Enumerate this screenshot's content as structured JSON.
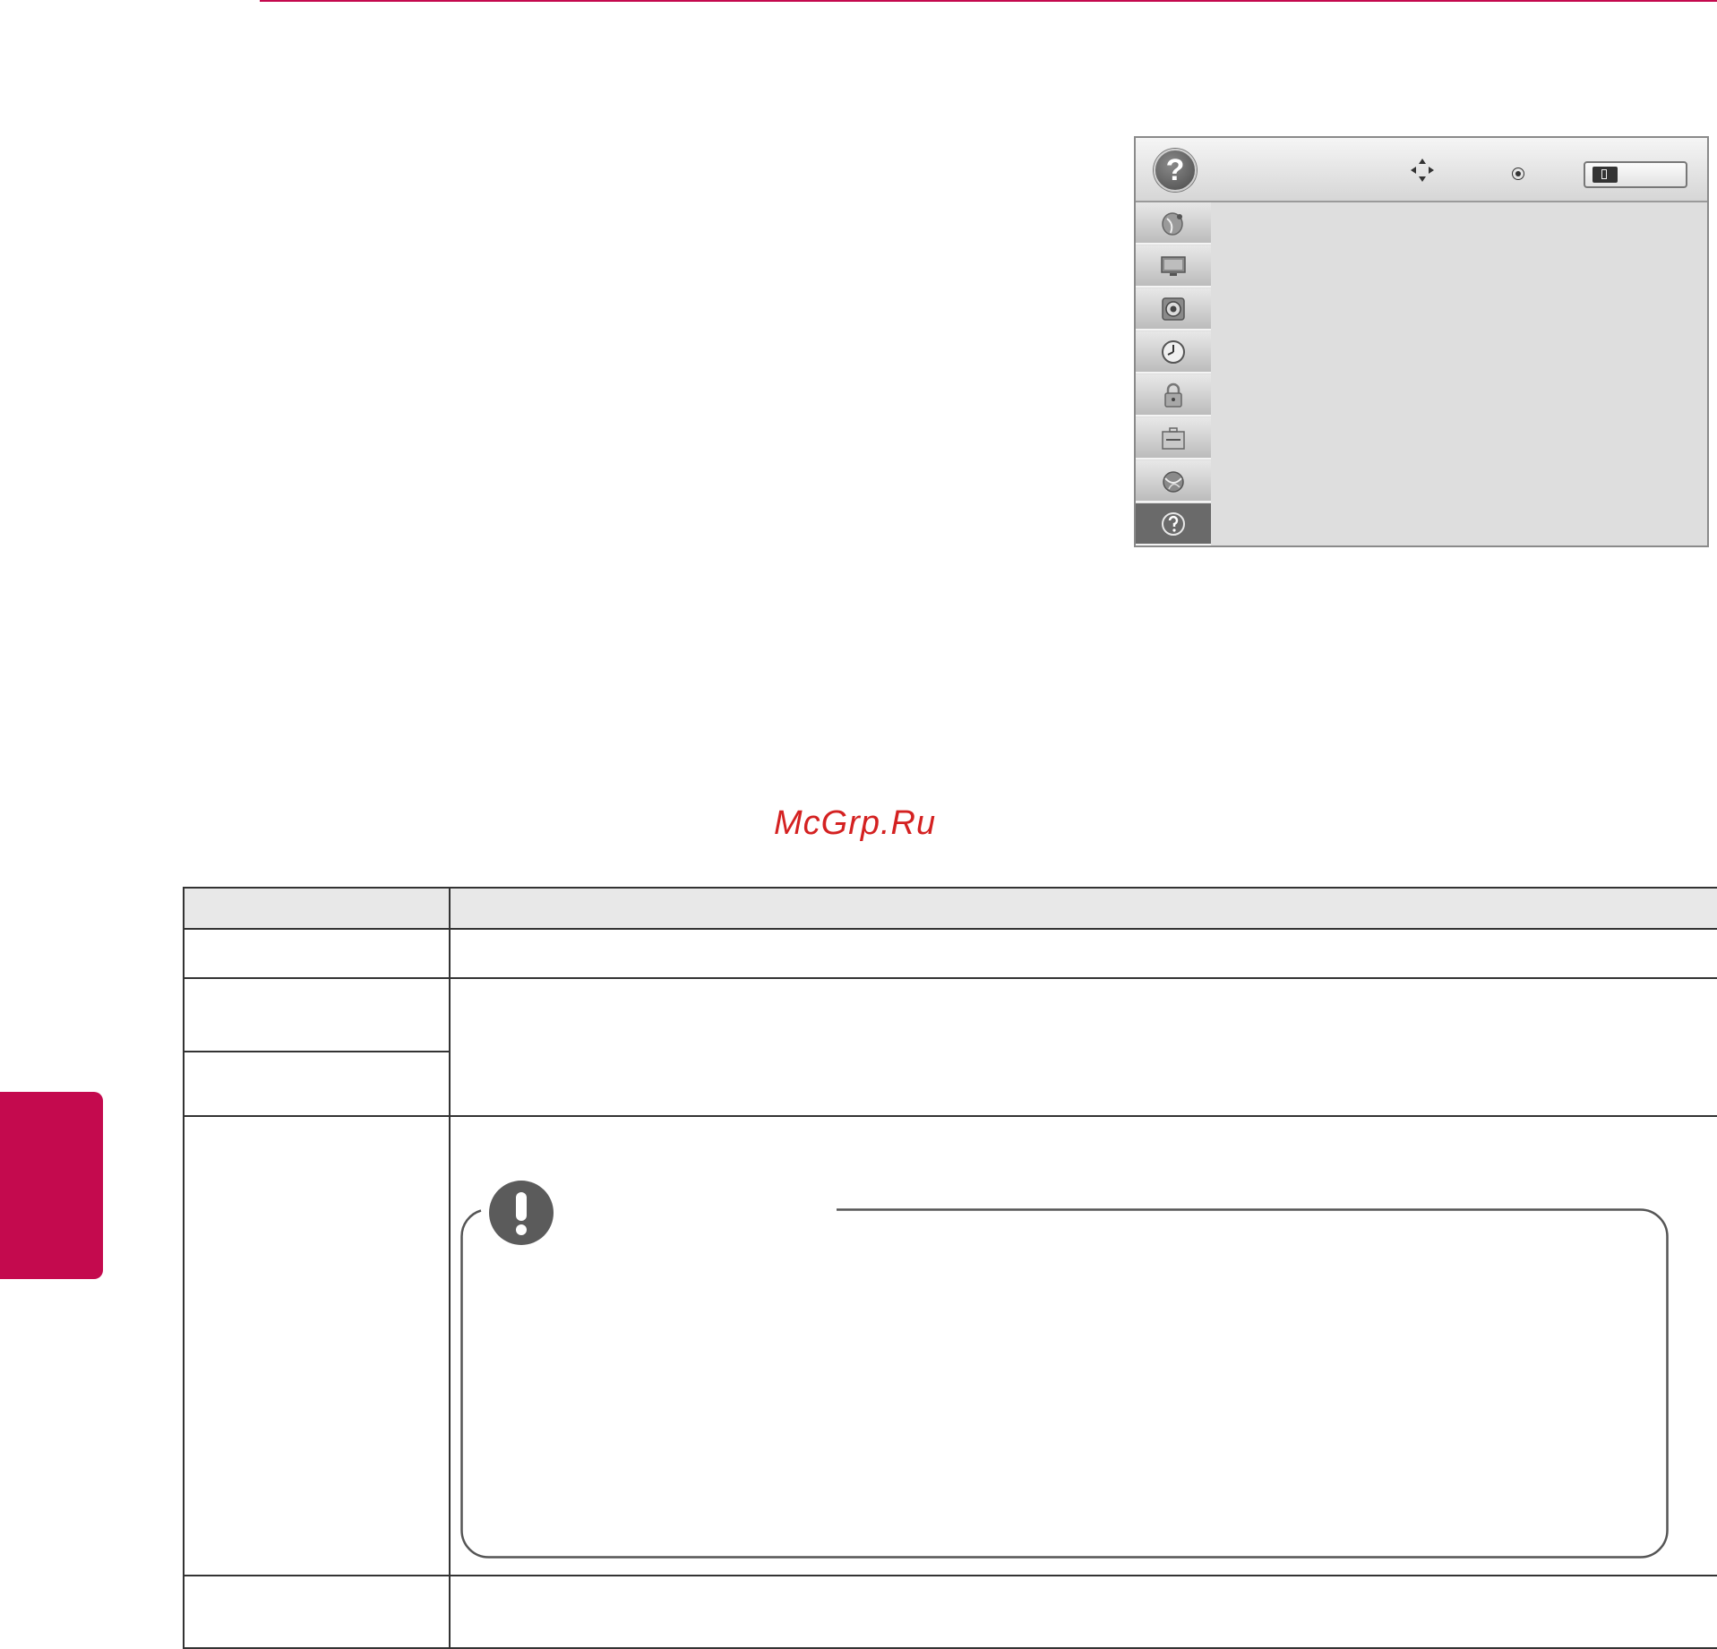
{
  "page": {
    "accent_color": "#c40a4e"
  },
  "watermark": {
    "text": "McGrp.Ru",
    "color": "#d42121"
  },
  "tv_menu": {
    "header_icon": "help-icon",
    "nav_hints": [
      "move-icon",
      "ok-icon",
      "exit-key-icon"
    ],
    "sidebar_items": [
      {
        "icon": "satellite-dish-icon",
        "selected": false
      },
      {
        "icon": "monitor-icon",
        "selected": false
      },
      {
        "icon": "speaker-icon",
        "selected": false
      },
      {
        "icon": "clock-icon",
        "selected": false
      },
      {
        "icon": "lock-icon",
        "selected": false
      },
      {
        "icon": "toolbox-icon",
        "selected": false
      },
      {
        "icon": "network-icon",
        "selected": false
      },
      {
        "icon": "help-icon",
        "selected": true
      }
    ]
  },
  "note": {
    "icon": "exclamation-icon"
  }
}
